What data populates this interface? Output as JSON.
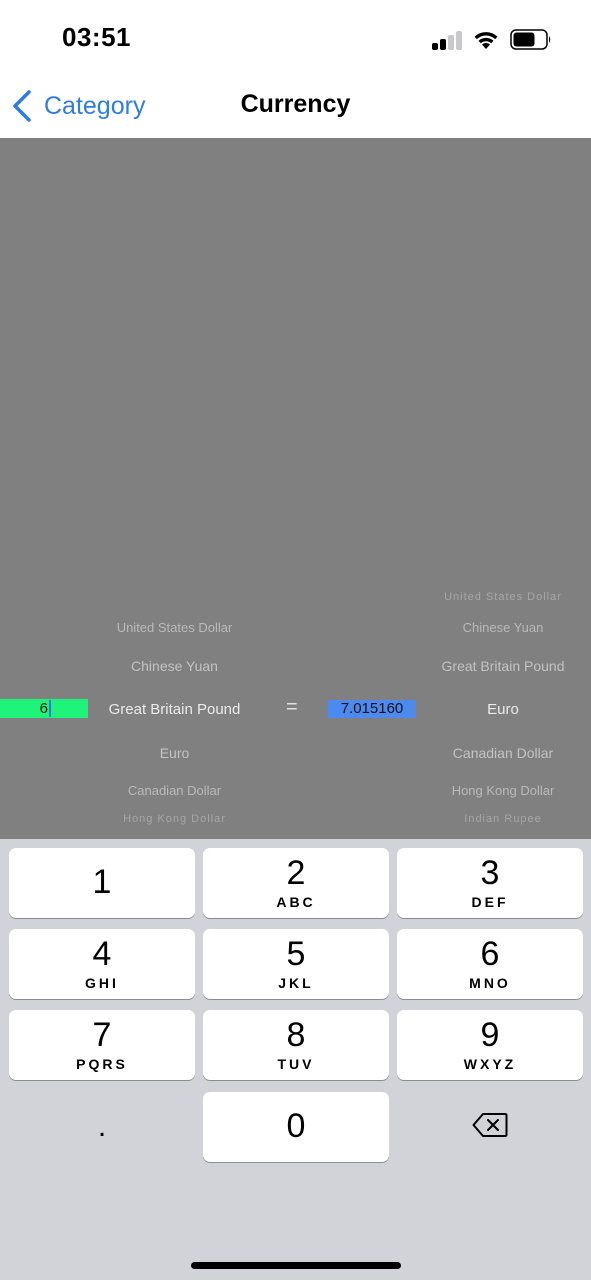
{
  "status_bar": {
    "time": "03:51",
    "icons": [
      "signal-icon",
      "wifi-icon",
      "battery-icon"
    ]
  },
  "nav": {
    "back_label": "Category",
    "title": "Currency",
    "accent_color": "#2f7ce3"
  },
  "converter": {
    "amount": "6",
    "equals": "=",
    "result": "7.015160",
    "amount_bg": "#1ef47a",
    "result_bg": "#4d8af0",
    "from_picker": {
      "items": [
        "United States Dollar",
        "Chinese Yuan",
        "Great Britain Pound",
        "Euro",
        "Canadian Dollar",
        "Hong Kong Dollar"
      ],
      "selected": "Great Britain Pound"
    },
    "to_picker": {
      "items": [
        "United States Dollar",
        "Chinese Yuan",
        "Great Britain Pound",
        "Euro",
        "Canadian Dollar",
        "Hong Kong Dollar",
        "Indian Rupee"
      ],
      "selected": "Euro"
    }
  },
  "keyboard": {
    "keys": [
      {
        "digit": "1",
        "letters": ""
      },
      {
        "digit": "2",
        "letters": "ABC"
      },
      {
        "digit": "3",
        "letters": "DEF"
      },
      {
        "digit": "4",
        "letters": "GHI"
      },
      {
        "digit": "5",
        "letters": "JKL"
      },
      {
        "digit": "6",
        "letters": "MNO"
      },
      {
        "digit": "7",
        "letters": "PQRS"
      },
      {
        "digit": "8",
        "letters": "TUV"
      },
      {
        "digit": "9",
        "letters": "WXYZ"
      },
      {
        "digit": "0",
        "letters": ""
      }
    ],
    "decimal": ".",
    "delete_icon": "delete-backspace-icon"
  }
}
